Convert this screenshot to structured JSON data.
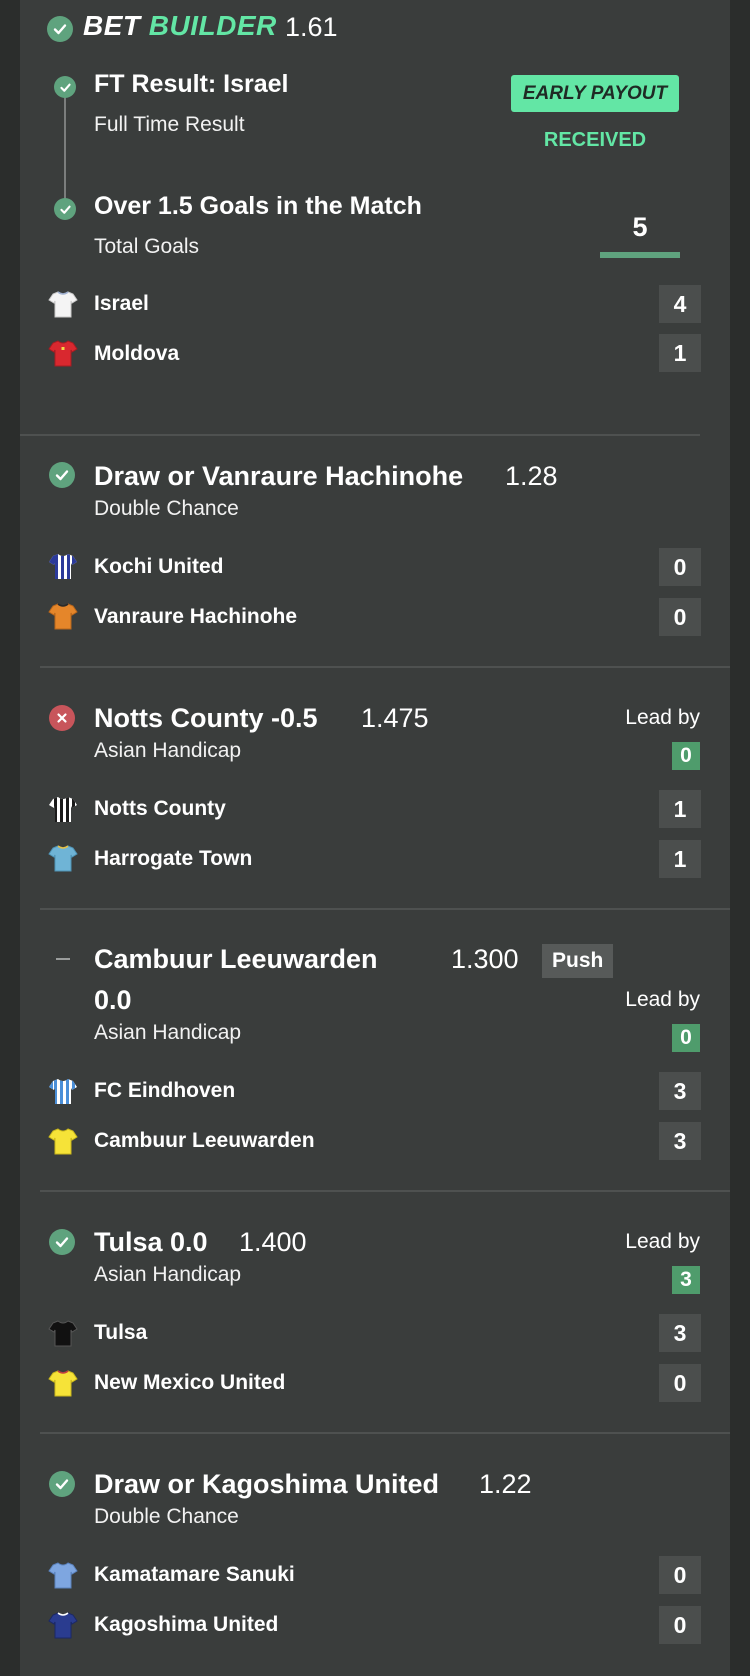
{
  "header": {
    "label_part1": "BET",
    "label_part2": "BUILDER",
    "odds": "1.61"
  },
  "bet_builder": {
    "leg1": {
      "title": "FT Result: Israel",
      "sub": "Full Time Result"
    },
    "leg2": {
      "title": "Over 1.5 Goals in the Match",
      "sub": "Total Goals"
    },
    "early_payout_label": "EARLY PAYOUT",
    "received_label": "RECEIVED",
    "goals_value": "5",
    "goals_progress": 1.0,
    "teams": [
      {
        "name": "Israel",
        "score": "4",
        "shirt": "white-shirt-icon"
      },
      {
        "name": "Moldova",
        "score": "1",
        "shirt": "red-shirt-icon"
      }
    ]
  },
  "selections": [
    {
      "status": "won",
      "title": "Draw or Vanraure Hachinohe",
      "odds": "1.28",
      "market": "Double Chance",
      "teams": [
        {
          "name": "Kochi United",
          "score": "0"
        },
        {
          "name": "Vanraure Hachinohe",
          "score": "0"
        }
      ]
    },
    {
      "status": "lost",
      "title": "Notts County -0.5",
      "odds": "1.475",
      "market": "Asian Handicap",
      "lead_label": "Lead by",
      "lead_value": "0",
      "teams": [
        {
          "name": "Notts County",
          "score": "1"
        },
        {
          "name": "Harrogate Town",
          "score": "1"
        }
      ]
    },
    {
      "status": "push",
      "title_line1": "Cambuur Leeuwarden",
      "title_line2": "0.0",
      "odds": "1.300",
      "push_label": "Push",
      "market": "Asian Handicap",
      "lead_label": "Lead by",
      "lead_value": "0",
      "teams": [
        {
          "name": "FC Eindhoven",
          "score": "3"
        },
        {
          "name": "Cambuur Leeuwarden",
          "score": "3"
        }
      ]
    },
    {
      "status": "won",
      "title": "Tulsa 0.0",
      "odds": "1.400",
      "market": "Asian Handicap",
      "lead_label": "Lead by",
      "lead_value": "3",
      "teams": [
        {
          "name": "Tulsa",
          "score": "3"
        },
        {
          "name": "New Mexico United",
          "score": "0"
        }
      ]
    },
    {
      "status": "won",
      "title": "Draw or Kagoshima United",
      "odds": "1.22",
      "market": "Double Chance",
      "teams": [
        {
          "name": "Kamatamare Sanuki",
          "score": "0"
        },
        {
          "name": "Kagoshima United",
          "score": "0"
        }
      ]
    }
  ],
  "colors": {
    "accent_green": "#63e6a5",
    "win_green": "#5fa37e",
    "loss_red": "#c8555b",
    "panel": "#3a3d3c"
  }
}
